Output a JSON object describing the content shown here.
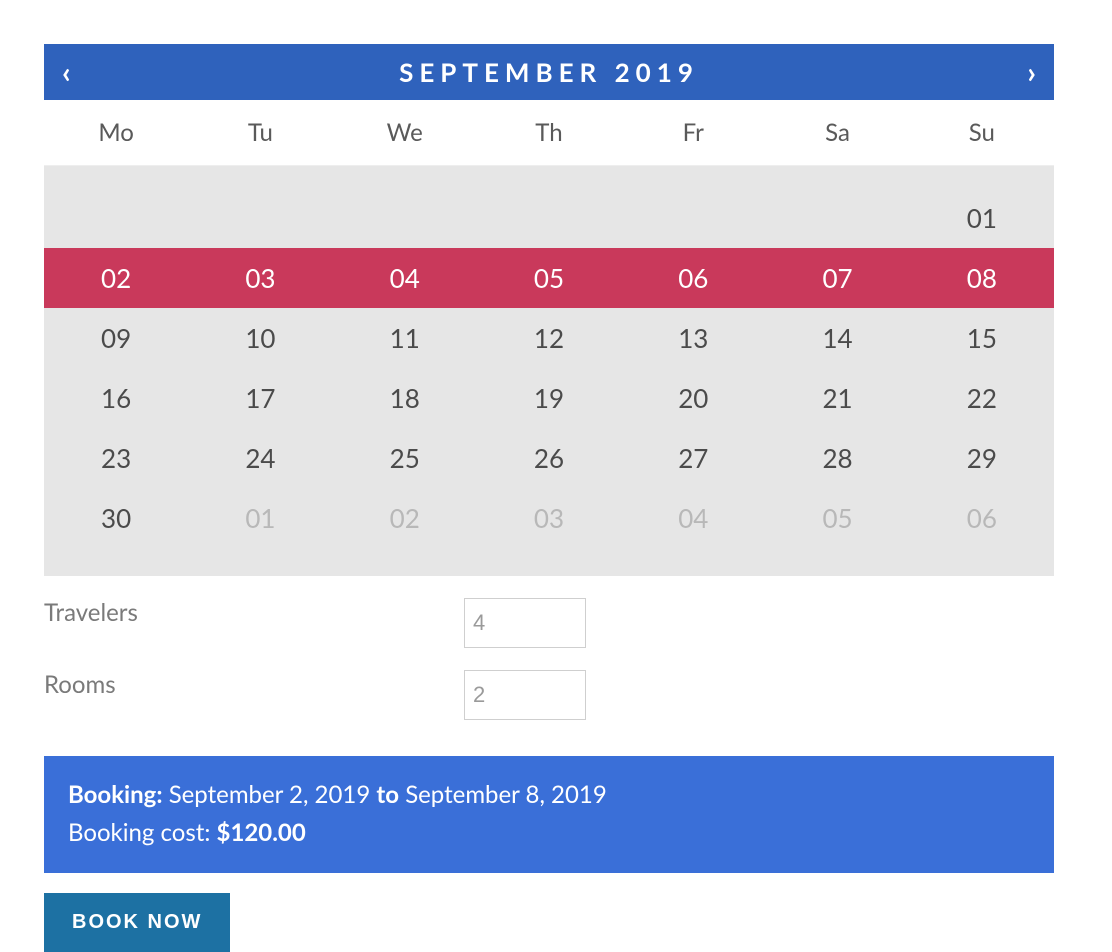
{
  "calendar": {
    "title": "SEPTEMBER 2019",
    "prev_glyph": "‹",
    "next_glyph": "›",
    "weekdays": [
      "Mo",
      "Tu",
      "We",
      "Th",
      "Fr",
      "Sa",
      "Su"
    ],
    "cells": [
      {
        "label": "",
        "out": false,
        "selected": false,
        "empty": true
      },
      {
        "label": "",
        "out": false,
        "selected": false,
        "empty": true
      },
      {
        "label": "",
        "out": false,
        "selected": false,
        "empty": true
      },
      {
        "label": "",
        "out": false,
        "selected": false,
        "empty": true
      },
      {
        "label": "",
        "out": false,
        "selected": false,
        "empty": true
      },
      {
        "label": "",
        "out": false,
        "selected": false,
        "empty": true
      },
      {
        "label": "01",
        "out": false,
        "selected": false
      },
      {
        "label": "02",
        "out": false,
        "selected": true
      },
      {
        "label": "03",
        "out": false,
        "selected": true
      },
      {
        "label": "04",
        "out": false,
        "selected": true
      },
      {
        "label": "05",
        "out": false,
        "selected": true
      },
      {
        "label": "06",
        "out": false,
        "selected": true
      },
      {
        "label": "07",
        "out": false,
        "selected": true
      },
      {
        "label": "08",
        "out": false,
        "selected": true
      },
      {
        "label": "09",
        "out": false,
        "selected": false
      },
      {
        "label": "10",
        "out": false,
        "selected": false
      },
      {
        "label": "11",
        "out": false,
        "selected": false
      },
      {
        "label": "12",
        "out": false,
        "selected": false
      },
      {
        "label": "13",
        "out": false,
        "selected": false
      },
      {
        "label": "14",
        "out": false,
        "selected": false
      },
      {
        "label": "15",
        "out": false,
        "selected": false
      },
      {
        "label": "16",
        "out": false,
        "selected": false
      },
      {
        "label": "17",
        "out": false,
        "selected": false
      },
      {
        "label": "18",
        "out": false,
        "selected": false
      },
      {
        "label": "19",
        "out": false,
        "selected": false
      },
      {
        "label": "20",
        "out": false,
        "selected": false
      },
      {
        "label": "21",
        "out": false,
        "selected": false
      },
      {
        "label": "22",
        "out": false,
        "selected": false
      },
      {
        "label": "23",
        "out": false,
        "selected": false
      },
      {
        "label": "24",
        "out": false,
        "selected": false
      },
      {
        "label": "25",
        "out": false,
        "selected": false
      },
      {
        "label": "26",
        "out": false,
        "selected": false
      },
      {
        "label": "27",
        "out": false,
        "selected": false
      },
      {
        "label": "28",
        "out": false,
        "selected": false
      },
      {
        "label": "29",
        "out": false,
        "selected": false
      },
      {
        "label": "30",
        "out": false,
        "selected": false
      },
      {
        "label": "01",
        "out": true,
        "selected": false
      },
      {
        "label": "02",
        "out": true,
        "selected": false
      },
      {
        "label": "03",
        "out": true,
        "selected": false
      },
      {
        "label": "04",
        "out": true,
        "selected": false
      },
      {
        "label": "05",
        "out": true,
        "selected": false
      },
      {
        "label": "06",
        "out": true,
        "selected": false
      }
    ]
  },
  "form": {
    "travelers_label": "Travelers",
    "travelers_value": "4",
    "rooms_label": "Rooms",
    "rooms_value": "2"
  },
  "summary": {
    "booking_label": "Booking:",
    "from_date": "September 2, 2019",
    "to_word": "to",
    "to_date": "September 8, 2019",
    "cost_label": "Booking cost:",
    "cost_value": "$120.00"
  },
  "actions": {
    "book_label": "BOOK NOW"
  }
}
